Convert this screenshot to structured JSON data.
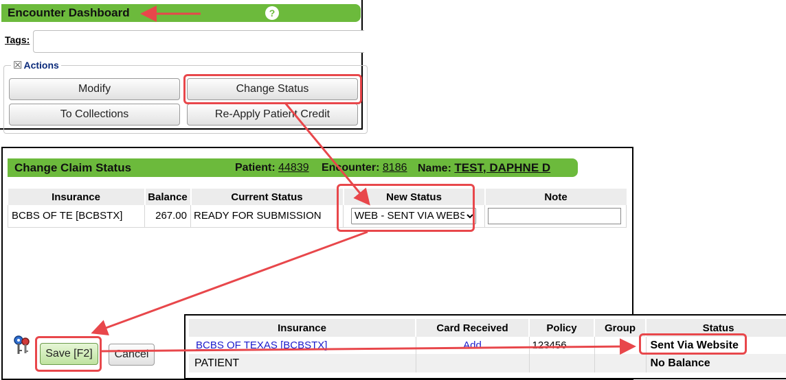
{
  "encounter": {
    "title": "Encounter Dashboard",
    "help": "?",
    "tags_label": "Tags:",
    "tags_value": "",
    "actions_legend": "Actions",
    "actions_toggle": "☒",
    "buttons": {
      "modify": "Modify",
      "change_status": "Change Status",
      "to_collections": "To Collections",
      "reapply_credit": "Re-Apply Patient Credit"
    }
  },
  "claim": {
    "title": "Change Claim Status",
    "patient_label": "Patient:",
    "patient_value": "44839",
    "encounter_label": "Encounter:",
    "encounter_value": "8186",
    "name_label": "Name:",
    "name_value": "TEST, DAPHNE D",
    "headers": [
      "Insurance",
      "Balance",
      "Current Status",
      "New Status",
      "Note"
    ],
    "row": {
      "insurance": "BCBS OF TE [BCBSTX]",
      "balance": "267.00",
      "current_status": "READY FOR SUBMISSION",
      "new_status": "WEB - SENT VIA WEBSITE",
      "note": ""
    },
    "save": "Save [F2]",
    "cancel": "Cancel"
  },
  "insurance": {
    "headers": [
      "Insurance",
      "Card Received",
      "Policy",
      "Group",
      "Status"
    ],
    "rows": [
      {
        "insurance": "BCBS OF TEXAS [BCBSTX]",
        "card": "Add",
        "policy": "123456",
        "group": "",
        "status": "Sent Via Website"
      },
      {
        "insurance": "PATIENT",
        "card": "",
        "policy": "",
        "group": "",
        "status": "No Balance"
      }
    ]
  },
  "colors": {
    "accent_green": "#6cba3c",
    "highlight_red": "#e8474b",
    "link_blue": "#1a1acc"
  }
}
